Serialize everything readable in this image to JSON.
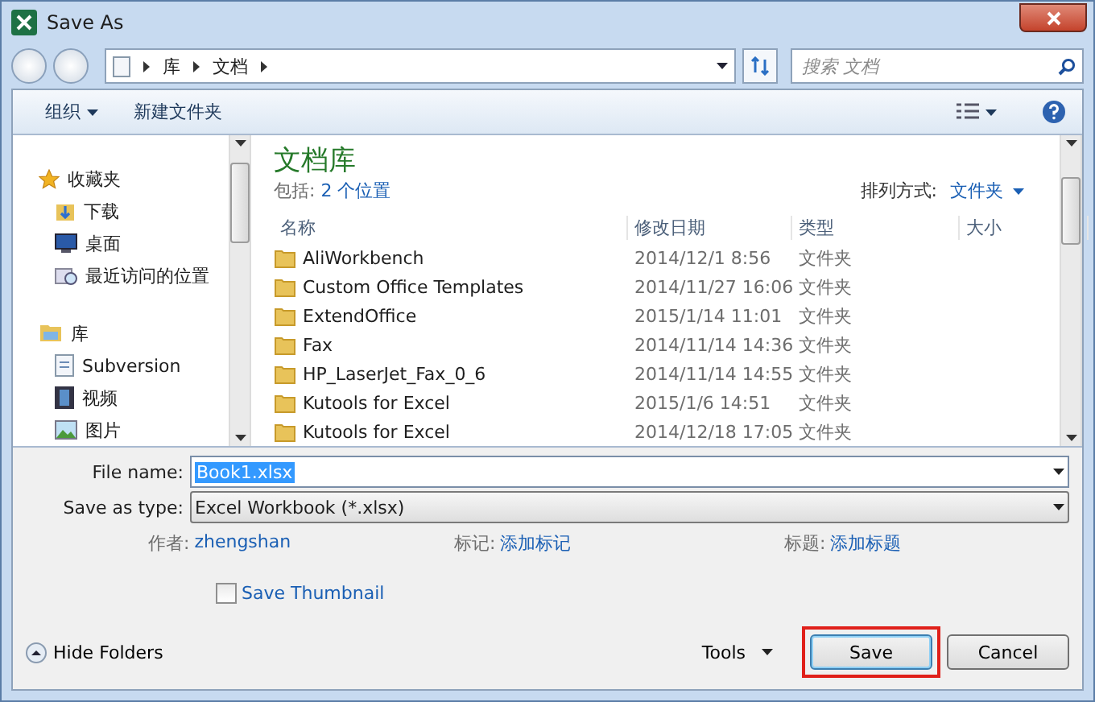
{
  "window": {
    "title": "Save As"
  },
  "address": {
    "path": [
      "库",
      "文档"
    ],
    "search_placeholder": "搜索 文档"
  },
  "toolbar": {
    "organize": "组织",
    "new_folder": "新建文件夹"
  },
  "sidebar": [
    {
      "label": "收藏夹",
      "kind": "star",
      "children": [
        {
          "label": "下载",
          "kind": "download"
        },
        {
          "label": "桌面",
          "kind": "desktop"
        },
        {
          "label": "最近访问的位置",
          "kind": "recent"
        }
      ]
    },
    {
      "label": "库",
      "kind": "library",
      "children": [
        {
          "label": "Subversion",
          "kind": "doc"
        },
        {
          "label": "视频",
          "kind": "video"
        },
        {
          "label": "图片",
          "kind": "picture"
        }
      ]
    }
  ],
  "library": {
    "title": "文档库",
    "includes_label": "包括:",
    "includes_link": "2 个位置",
    "arrange_label": "排列方式:",
    "arrange_value": "文件夹"
  },
  "table": {
    "columns": [
      "名称",
      "修改日期",
      "类型",
      "大小"
    ],
    "rows": [
      {
        "name": "AliWorkbench",
        "date": "2014/12/1 8:56",
        "type": "文件夹"
      },
      {
        "name": "Custom Office Templates",
        "date": "2014/11/27 16:06",
        "type": "文件夹"
      },
      {
        "name": "ExtendOffice",
        "date": "2015/1/14 11:01",
        "type": "文件夹"
      },
      {
        "name": "Fax",
        "date": "2014/11/14 14:36",
        "type": "文件夹"
      },
      {
        "name": "HP_LaserJet_Fax_0_6",
        "date": "2014/11/14 14:55",
        "type": "文件夹"
      },
      {
        "name": "Kutools for Excel",
        "date": "2015/1/6 14:51",
        "type": "文件夹"
      },
      {
        "name": "Kutools for Excel",
        "date": "2014/12/18 17:05",
        "type": "文件夹"
      }
    ]
  },
  "form": {
    "file_name_label": "File name:",
    "file_name": "Book1.xlsx",
    "file_name_selected": true,
    "type_label": "Save as type:",
    "type_value": "Excel Workbook (*.xlsx)",
    "meta": [
      {
        "label": "作者:",
        "value": "zhengshan"
      },
      {
        "label": "标记:",
        "value": "添加标记"
      },
      {
        "label": "标题:",
        "value": "添加标题"
      }
    ],
    "thumbnail": {
      "label": "Save Thumbnail",
      "checked": false
    }
  },
  "footer": {
    "hide_folders": "Hide Folders",
    "tools": "Tools",
    "save": "Save",
    "save_highlighted": true,
    "cancel": "Cancel"
  }
}
